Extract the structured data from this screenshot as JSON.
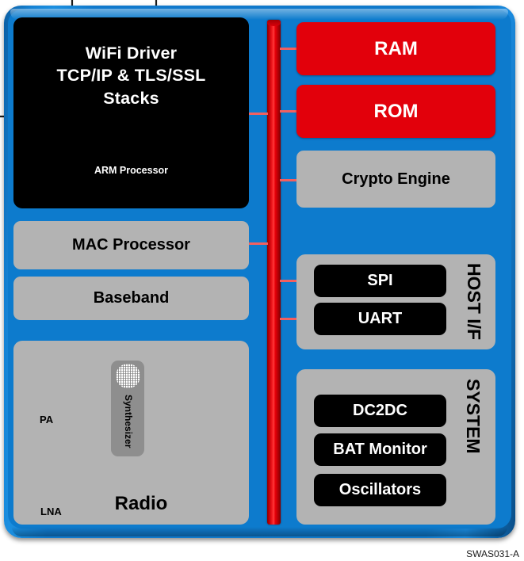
{
  "diagram": {
    "doc_id": "SWAS031-A",
    "colors": {
      "package": "#0d7bcd",
      "memory": "#e2000b",
      "logic_gray": "#b3b3b3",
      "processor_black": "#000000",
      "bus_red": "#e2000b",
      "connector_red": "#f26060",
      "synth_gray": "#8e8e8e"
    },
    "processor": {
      "title": "WiFi  Driver\nTCP/IP  & TLS/SSL\nStacks",
      "title_lines": [
        "WiFi  Driver",
        "TCP/IP  & TLS/SSL",
        "Stacks"
      ],
      "subtitle": "ARM Processor"
    },
    "left_blocks": [
      {
        "label": "MAC Processor"
      },
      {
        "label": "Baseband"
      }
    ],
    "radio": {
      "label": "Radio",
      "pa_label": "PA",
      "lna_label": "LNA",
      "synthesizer_label": "Synthesizer"
    },
    "memory_blocks": [
      {
        "label": "RAM"
      },
      {
        "label": "ROM"
      }
    ],
    "crypto": {
      "label": "Crypto Engine"
    },
    "host_if": {
      "group_label": "HOST I/F",
      "items": [
        {
          "label": "SPI"
        },
        {
          "label": "UART"
        }
      ]
    },
    "system": {
      "group_label": "SYSTEM",
      "items": [
        {
          "label": "DC2DC"
        },
        {
          "label": "BAT Monitor"
        },
        {
          "label": "Oscillators"
        }
      ]
    }
  },
  "chart_data": {
    "type": "diagram",
    "title": "WiFi SoC Block Diagram",
    "nodes": [
      {
        "id": "arm",
        "label": "WiFi Driver / TCP/IP & TLS/SSL Stacks (ARM Processor)",
        "style": "black",
        "side": "left"
      },
      {
        "id": "mac",
        "label": "MAC Processor",
        "style": "gray",
        "side": "left"
      },
      {
        "id": "baseband",
        "label": "Baseband",
        "style": "gray",
        "side": "left"
      },
      {
        "id": "radio",
        "label": "Radio",
        "style": "gray",
        "side": "left"
      },
      {
        "id": "ram",
        "label": "RAM",
        "style": "red",
        "side": "right"
      },
      {
        "id": "rom",
        "label": "ROM",
        "style": "red",
        "side": "right"
      },
      {
        "id": "crypto",
        "label": "Crypto Engine",
        "style": "gray",
        "side": "right"
      },
      {
        "id": "spi",
        "label": "SPI",
        "style": "black",
        "side": "right",
        "group": "HOST I/F"
      },
      {
        "id": "uart",
        "label": "UART",
        "style": "black",
        "side": "right",
        "group": "HOST I/F"
      },
      {
        "id": "dc2dc",
        "label": "DC2DC",
        "style": "black",
        "side": "right",
        "group": "SYSTEM"
      },
      {
        "id": "bat",
        "label": "BAT Monitor",
        "style": "black",
        "side": "right",
        "group": "SYSTEM"
      },
      {
        "id": "osc",
        "label": "Oscillators",
        "style": "black",
        "side": "right",
        "group": "SYSTEM"
      }
    ],
    "bus": {
      "id": "system-bus",
      "orientation": "vertical",
      "color": "#e2000b"
    },
    "edges": [
      {
        "from": "arm",
        "to": "system-bus"
      },
      {
        "from": "mac",
        "to": "system-bus"
      },
      {
        "from": "system-bus",
        "to": "ram"
      },
      {
        "from": "system-bus",
        "to": "rom"
      },
      {
        "from": "system-bus",
        "to": "crypto"
      },
      {
        "from": "system-bus",
        "to": "spi"
      },
      {
        "from": "system-bus",
        "to": "uart"
      }
    ]
  }
}
